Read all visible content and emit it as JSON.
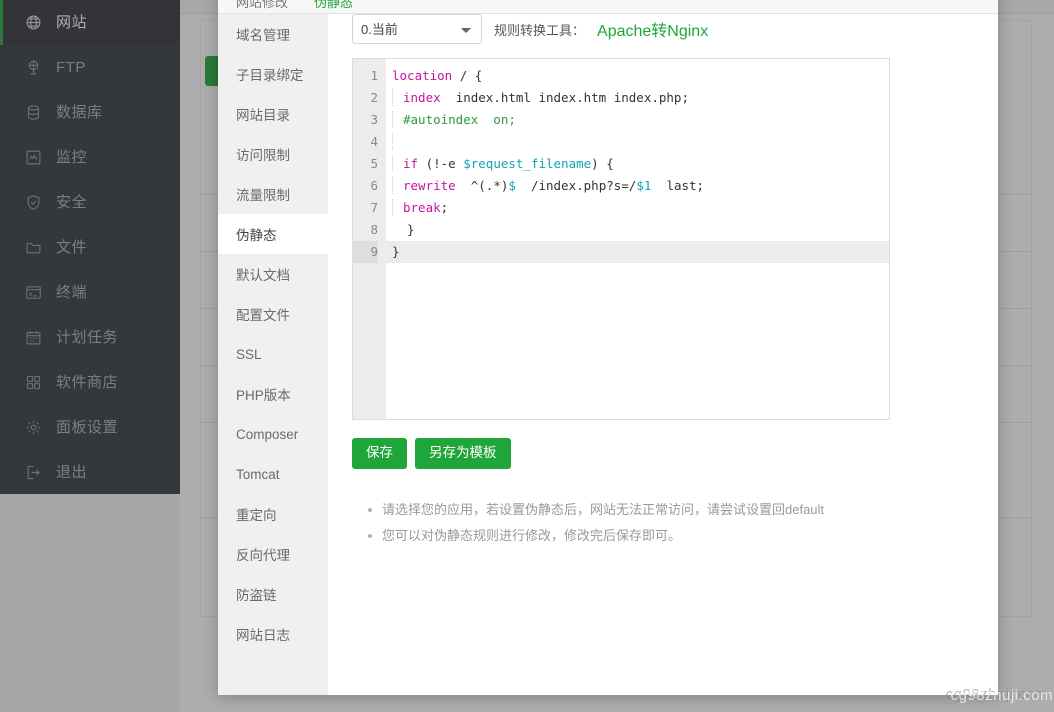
{
  "colors": {
    "accent": "#20a53a",
    "sidebar_bg": "#31363c",
    "sidebar_active_bg": "#2b3036",
    "keyword": "#c813a0",
    "comment": "#2e9b3f",
    "variable": "#12a4b4"
  },
  "sidebar": {
    "items": [
      {
        "label": "网站",
        "icon": "globe-icon",
        "active": true
      },
      {
        "label": "FTP",
        "icon": "ftp-icon",
        "active": false
      },
      {
        "label": "数据库",
        "icon": "database-icon",
        "active": false
      },
      {
        "label": "监控",
        "icon": "monitor-icon",
        "active": false
      },
      {
        "label": "安全",
        "icon": "shield-icon",
        "active": false
      },
      {
        "label": "文件",
        "icon": "folder-icon",
        "active": false
      },
      {
        "label": "终端",
        "icon": "terminal-icon",
        "active": false
      },
      {
        "label": "计划任务",
        "icon": "calendar-icon",
        "active": false
      },
      {
        "label": "软件商店",
        "icon": "grid-icon",
        "active": false
      },
      {
        "label": "面板设置",
        "icon": "gear-icon",
        "active": false
      },
      {
        "label": "退出",
        "icon": "logout-icon",
        "active": false
      }
    ]
  },
  "modal": {
    "tabs": [
      {
        "label": "网站修改",
        "current": false
      },
      {
        "label": "伪静态",
        "current": true
      }
    ],
    "sub_nav": {
      "items": [
        {
          "label": "域名管理",
          "active": false
        },
        {
          "label": "子目录绑定",
          "active": false
        },
        {
          "label": "网站目录",
          "active": false
        },
        {
          "label": "访问限制",
          "active": false
        },
        {
          "label": "流量限制",
          "active": false
        },
        {
          "label": "伪静态",
          "active": true
        },
        {
          "label": "默认文档",
          "active": false
        },
        {
          "label": "配置文件",
          "active": false
        },
        {
          "label": "SSL",
          "active": false
        },
        {
          "label": "PHP版本",
          "active": false
        },
        {
          "label": "Composer",
          "active": false
        },
        {
          "label": "Tomcat",
          "active": false
        },
        {
          "label": "重定向",
          "active": false
        },
        {
          "label": "反向代理",
          "active": false
        },
        {
          "label": "防盗链",
          "active": false
        },
        {
          "label": "网站日志",
          "active": false
        }
      ]
    },
    "toolbar": {
      "template_select_value": "0.当前",
      "template_options": [
        "0.当前"
      ],
      "converter_label": "规则转换工具：",
      "converter_link": "Apache转Nginx"
    },
    "editor": {
      "active_line": 9,
      "lines": [
        {
          "n": "1",
          "indent": 0,
          "tokens": [
            {
              "t": "location ",
              "c": "kw"
            },
            {
              "t": "/ {",
              "c": "pl"
            }
          ]
        },
        {
          "n": "2",
          "indent": 1,
          "tokens": [
            {
              "t": "index",
              "c": "kw"
            },
            {
              "t": "  index.html index.htm index.php;",
              "c": "pl"
            }
          ]
        },
        {
          "n": "3",
          "indent": 1,
          "tokens": [
            {
              "t": "#autoindex  on;",
              "c": "cm"
            }
          ]
        },
        {
          "n": "4",
          "indent": 1,
          "tokens": []
        },
        {
          "n": "5",
          "indent": 1,
          "tokens": [
            {
              "t": "if",
              "c": "kw"
            },
            {
              "t": " (!-e ",
              "c": "pl"
            },
            {
              "t": "$request_filename",
              "c": "var"
            },
            {
              "t": ") {",
              "c": "pl"
            }
          ]
        },
        {
          "n": "6",
          "indent": 1,
          "tokens": [
            {
              "t": "rewrite",
              "c": "kw"
            },
            {
              "t": "  ^(.*)",
              "c": "pl"
            },
            {
              "t": "$",
              "c": "var"
            },
            {
              "t": "  /index.php?s=/",
              "c": "pl"
            },
            {
              "t": "$1",
              "c": "var"
            },
            {
              "t": "  last;",
              "c": "pl"
            }
          ]
        },
        {
          "n": "7",
          "indent": 1,
          "tokens": [
            {
              "t": "break",
              "c": "kw"
            },
            {
              "t": ";",
              "c": "pl"
            }
          ]
        },
        {
          "n": "8",
          "indent": 0,
          "tokens": [
            {
              "t": "  }",
              "c": "pl"
            }
          ]
        },
        {
          "n": "9",
          "indent": 0,
          "tokens": [
            {
              "t": "}",
              "c": "pl"
            }
          ]
        }
      ]
    },
    "buttons": {
      "save": "保存",
      "save_as_template": "另存为模板"
    },
    "hints": [
      "请选择您的应用，若设置伪静态后，网站无法正常访问，请尝试设置回default",
      "您可以对伪静态规则进行修改，修改完后保存即可。"
    ]
  },
  "watermark": {
    "text": "cg98zhuji.com"
  }
}
